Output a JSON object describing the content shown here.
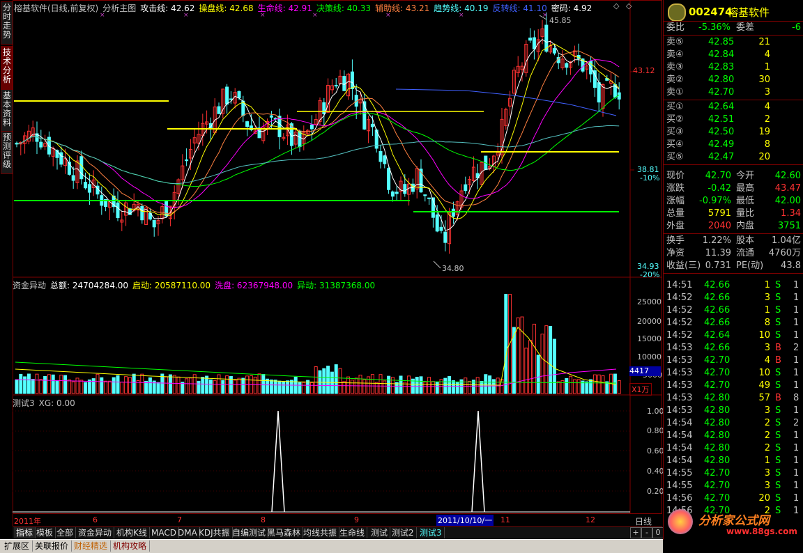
{
  "colors": {
    "up": "#ff3232",
    "down": "#54ffff",
    "ma_white": "#ffffff",
    "ma_yellow": "#ffff00",
    "ma_magenta": "#ff00ff",
    "ma_green": "#00ff00",
    "ma_cyan": "#54c0c0",
    "ma_blue": "#4060ff",
    "orange": "#ff8040",
    "hline_yellow": "#ffff00",
    "hline_green": "#00ff00"
  },
  "left_tabs": [
    "分时走势",
    "技术分析",
    "基本资料",
    "预测评级"
  ],
  "main_title": {
    "name": "榕基软件(日线,前复权)",
    "indicator": "分析主图",
    "items": [
      {
        "label": "攻击线:",
        "value": "42.62",
        "color": "#ffffff"
      },
      {
        "label": "操盘线:",
        "value": "42.68",
        "color": "#ffff00"
      },
      {
        "label": "生命线:",
        "value": "42.91",
        "color": "#ff00ff"
      },
      {
        "label": "决策线:",
        "value": "40.33",
        "color": "#00ff00"
      },
      {
        "label": "辅助线:",
        "value": "43.21",
        "color": "#ff8040"
      },
      {
        "label": "趋势线:",
        "value": "40.19",
        "color": "#54ffff"
      },
      {
        "label": "反转线:",
        "value": "41.10",
        "color": "#4060ff"
      },
      {
        "label": "密码:",
        "value": "4.92",
        "color": "#ffffff"
      }
    ]
  },
  "price_axis": {
    "labels": [
      "43.12",
      "38.81",
      "-10%",
      "34.93",
      "-20%"
    ]
  },
  "annotations": {
    "high": "45.85",
    "low": "34.80"
  },
  "volume_title": {
    "name": "资金异动",
    "items": [
      {
        "label": "总额:",
        "value": "24704284.00",
        "color": "#ffffff"
      },
      {
        "label": "启动:",
        "value": "20587110.00",
        "color": "#ffff00"
      },
      {
        "label": "洗盘:",
        "value": "62367948.00",
        "color": "#ff00ff"
      },
      {
        "label": "异动:",
        "value": "31387368.00",
        "color": "#00ff00"
      }
    ]
  },
  "volume_axis": {
    "labels": [
      "25000",
      "20000",
      "15000",
      "10000",
      "5000"
    ],
    "current": "4417",
    "unit": "X1万"
  },
  "test_title": {
    "name": "测试3",
    "items": [
      {
        "label": "XG:",
        "value": "0.00",
        "color": "#c0c0c0"
      }
    ]
  },
  "test_axis": {
    "labels": [
      "1.00",
      "0.80",
      "0.60",
      "0.40",
      "0.20"
    ]
  },
  "date_axis": {
    "labels": [
      "2011年",
      "6",
      "7",
      "8",
      "9",
      "2011/10/10/一",
      "11",
      "12"
    ],
    "period": "日线"
  },
  "bottom_tabs": [
    "指标",
    "模板",
    "全部",
    "资金异动",
    "机构K线",
    "MACD",
    "DMA",
    "KDJ共振",
    "自编测试",
    "黑马森林",
    "均线共振",
    "生命线",
    "测试",
    "测试2",
    "测试3"
  ],
  "status_tabs": [
    "扩展区",
    "关联报价",
    "财经精选",
    "机构攻略"
  ],
  "right": {
    "code": "002474",
    "name": "榕基软件",
    "weibi": {
      "label": "委比",
      "value": "-5.36%",
      "label2": "委差",
      "value2": "-6"
    },
    "sells": [
      {
        "label": "卖⑤",
        "price": "42.85",
        "vol": "21"
      },
      {
        "label": "卖④",
        "price": "42.84",
        "vol": "4"
      },
      {
        "label": "卖③",
        "price": "42.83",
        "vol": "1"
      },
      {
        "label": "卖②",
        "price": "42.80",
        "vol": "30"
      },
      {
        "label": "卖①",
        "price": "42.70",
        "vol": "3"
      }
    ],
    "buys": [
      {
        "label": "买①",
        "price": "42.64",
        "vol": "4"
      },
      {
        "label": "买②",
        "price": "42.51",
        "vol": "2"
      },
      {
        "label": "买③",
        "price": "42.50",
        "vol": "19"
      },
      {
        "label": "买④",
        "price": "42.49",
        "vol": "8"
      },
      {
        "label": "买⑤",
        "price": "42.47",
        "vol": "20"
      }
    ],
    "quote": [
      {
        "l1": "现价",
        "v1": "42.70",
        "c1": "#00ff00",
        "l2": "今开",
        "v2": "42.60",
        "c2": "#00ff00"
      },
      {
        "l1": "涨跌",
        "v1": "-0.42",
        "c1": "#00ff00",
        "l2": "最高",
        "v2": "43.47",
        "c2": "#ff3232"
      },
      {
        "l1": "涨幅",
        "v1": "-0.97%",
        "c1": "#00ff00",
        "l2": "最低",
        "v2": "42.00",
        "c2": "#00ff00"
      },
      {
        "l1": "总量",
        "v1": "5791",
        "c1": "#ffff00",
        "l2": "量比",
        "v2": "1.34",
        "c2": "#ff3232"
      },
      {
        "l1": "外盘",
        "v1": "2040",
        "c1": "#ff3232",
        "l2": "内盘",
        "v2": "3751",
        "c2": "#00ff00"
      }
    ],
    "fund": [
      {
        "l1": "换手",
        "v1": "1.22%",
        "l2": "股本",
        "v2": "1.04亿"
      },
      {
        "l1": "净资",
        "v1": "11.39",
        "l2": "流通",
        "v2": "4760万"
      },
      {
        "l1": "收益(三)",
        "v1": "0.731",
        "l2": "PE(动)",
        "v2": "43.8"
      }
    ],
    "ticks": [
      {
        "t": "14:51",
        "p": "42.66",
        "v": "1",
        "d": "S",
        "n": "1"
      },
      {
        "t": "14:52",
        "p": "42.66",
        "v": "3",
        "d": "S",
        "n": "1"
      },
      {
        "t": "14:52",
        "p": "42.66",
        "v": "1",
        "d": "S",
        "n": "1"
      },
      {
        "t": "14:52",
        "p": "42.66",
        "v": "8",
        "d": "S",
        "n": "1"
      },
      {
        "t": "14:52",
        "p": "42.64",
        "v": "10",
        "d": "S",
        "n": "1"
      },
      {
        "t": "14:53",
        "p": "42.66",
        "v": "3",
        "d": "B",
        "n": "2"
      },
      {
        "t": "14:53",
        "p": "42.70",
        "v": "4",
        "d": "B",
        "n": "1"
      },
      {
        "t": "14:53",
        "p": "42.70",
        "v": "10",
        "d": "S",
        "n": "1"
      },
      {
        "t": "14:53",
        "p": "42.70",
        "v": "49",
        "d": "S",
        "n": "1"
      },
      {
        "t": "14:53",
        "p": "42.80",
        "v": "57",
        "d": "B",
        "n": "8"
      },
      {
        "t": "14:53",
        "p": "42.80",
        "v": "3",
        "d": "S",
        "n": "1"
      },
      {
        "t": "14:54",
        "p": "42.80",
        "v": "2",
        "d": "S",
        "n": "2"
      },
      {
        "t": "14:54",
        "p": "42.80",
        "v": "2",
        "d": "S",
        "n": "1"
      },
      {
        "t": "14:54",
        "p": "42.80",
        "v": "2",
        "d": "S",
        "n": "1"
      },
      {
        "t": "14:54",
        "p": "42.80",
        "v": "1",
        "d": "S",
        "n": "1"
      },
      {
        "t": "14:55",
        "p": "42.70",
        "v": "3",
        "d": "S",
        "n": "1"
      },
      {
        "t": "14:55",
        "p": "42.70",
        "v": "3",
        "d": "S",
        "n": "1"
      },
      {
        "t": "14:56",
        "p": "42.70",
        "v": "20",
        "d": "S",
        "n": "1"
      },
      {
        "t": "14:56",
        "p": "42.70",
        "v": "2",
        "d": "S",
        "n": "1"
      }
    ]
  },
  "watermark": {
    "text": "分析家公式网",
    "url": "www.88gs.com"
  }
}
